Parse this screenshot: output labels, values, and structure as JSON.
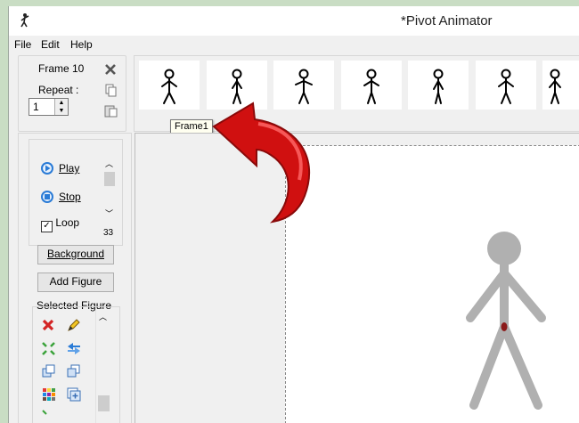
{
  "window": {
    "title": "*Pivot Animator"
  },
  "menu": {
    "file": "File",
    "edit": "Edit",
    "help": "Help"
  },
  "frame_info": {
    "frame_label": "Frame 10",
    "repeat_label": "Repeat :",
    "repeat_value": "1"
  },
  "timeline": {
    "tooltip": "Frame1",
    "thumb_count": 7
  },
  "playback": {
    "play_label": "Play",
    "stop_label": "Stop",
    "loop_label": "Loop",
    "loop_checked": true,
    "speed_value": "33"
  },
  "buttons": {
    "background": "Background",
    "add_figure": "Add Figure"
  },
  "selected_figure": {
    "label": "Selected Figure"
  },
  "colors": {
    "figure_gray": "#b0b0b0",
    "arrow_red": "#d01010",
    "joint_red": "#8b1a1a",
    "play_blue": "#2a7bd6",
    "frame_bg": "#c9ddc4"
  },
  "icons": {
    "delete_frame": "close-icon",
    "copy_frame": "copy-icon",
    "paste_frame": "paste-icon",
    "play": "play-icon",
    "stop": "stop-icon",
    "delete_figure": "delete-icon",
    "edit_figure": "pencil-icon",
    "center_figure": "center-icon",
    "flip_figure": "flip-icon",
    "back_figure": "send-back-icon",
    "front_figure": "bring-front-icon",
    "color_figure": "color-palette-icon",
    "add_to_figure": "add-icon"
  }
}
